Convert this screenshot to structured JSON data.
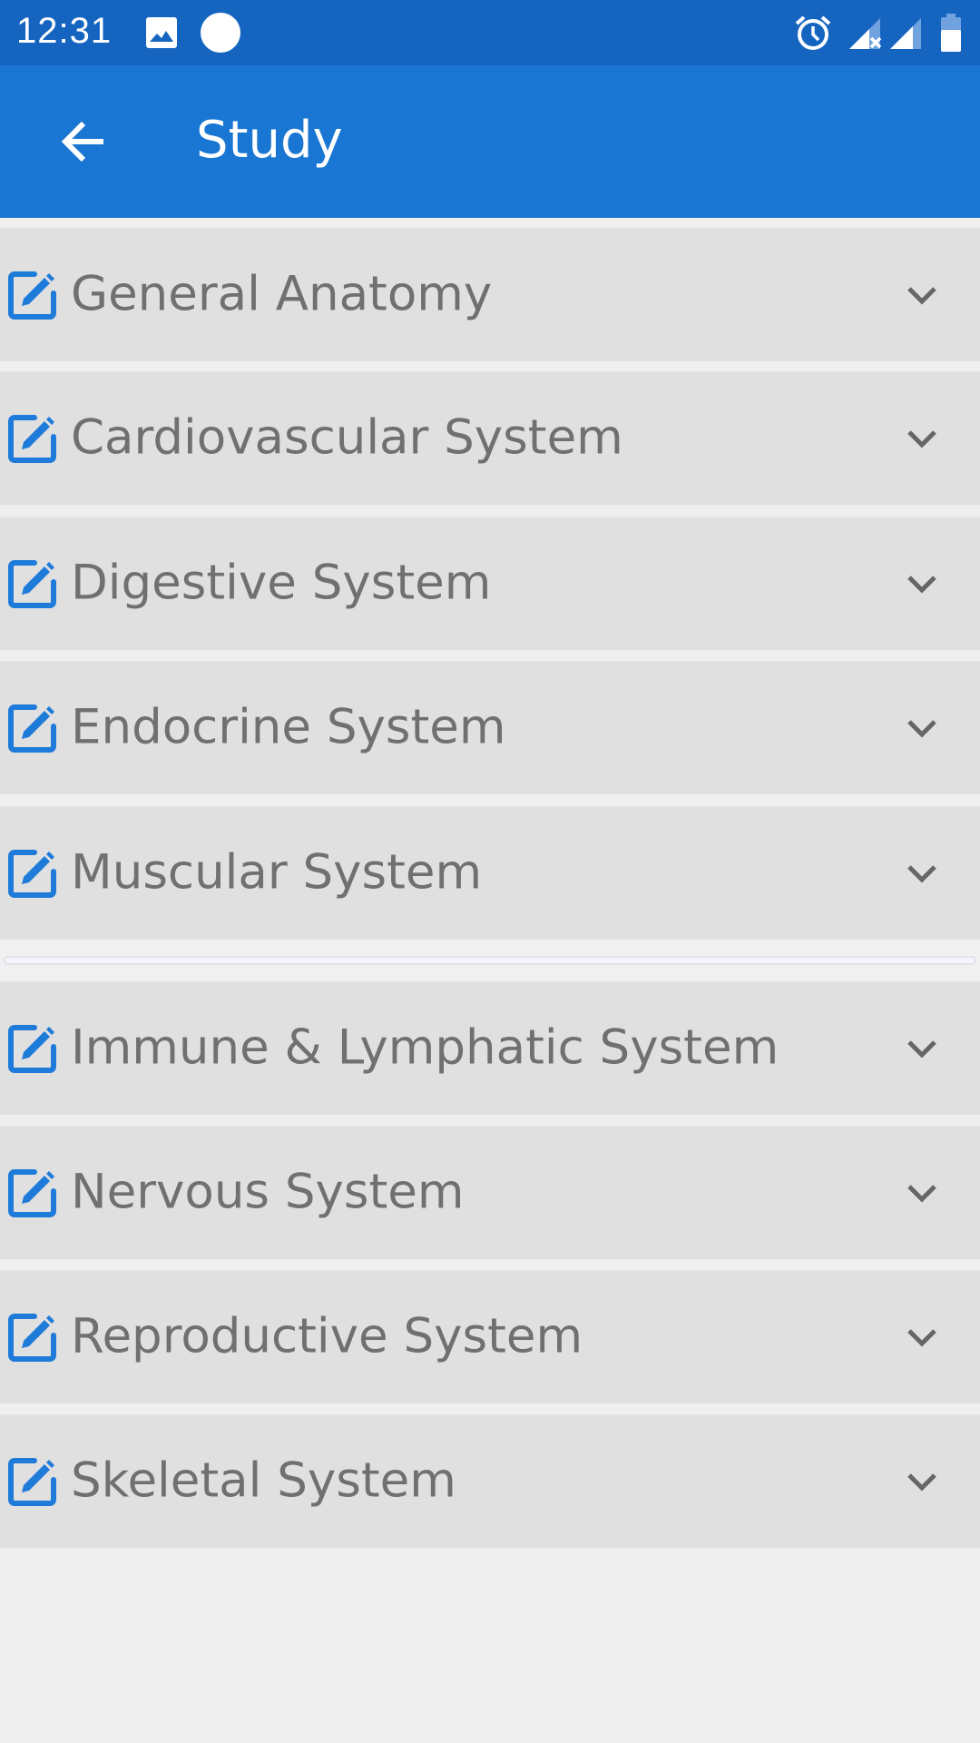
{
  "status_bar": {
    "time": "12:31",
    "left_icons": [
      "image-icon",
      "circle-notification-icon"
    ],
    "right_icons": [
      "alarm-icon",
      "signal-no-data-icon",
      "signal-icon",
      "battery-icon"
    ]
  },
  "app_bar": {
    "back_icon": "arrow-back-icon",
    "title": "Study"
  },
  "colors": {
    "status_bar": "#1565C0",
    "app_bar": "#1976D2",
    "accent_icon": "#1E7BD9",
    "row_background": "#E0E0E0",
    "row_text": "#707070",
    "page_background": "#EFEFEF"
  },
  "sections": [
    {
      "label": "General Anatomy",
      "icon": "edit-icon",
      "expand_icon": "chevron-down-icon"
    },
    {
      "label": "Cardiovascular System",
      "icon": "edit-icon",
      "expand_icon": "chevron-down-icon"
    },
    {
      "label": "Digestive System",
      "icon": "edit-icon",
      "expand_icon": "chevron-down-icon"
    },
    {
      "label": "Endocrine System",
      "icon": "edit-icon",
      "expand_icon": "chevron-down-icon"
    },
    {
      "label": "Muscular System",
      "icon": "edit-icon",
      "expand_icon": "chevron-down-icon"
    },
    {
      "label": "Immune & Lymphatic System",
      "icon": "edit-icon",
      "expand_icon": "chevron-down-icon"
    },
    {
      "label": "Nervous System",
      "icon": "edit-icon",
      "expand_icon": "chevron-down-icon"
    },
    {
      "label": "Reproductive System",
      "icon": "edit-icon",
      "expand_icon": "chevron-down-icon"
    },
    {
      "label": "Skeletal System",
      "icon": "edit-icon",
      "expand_icon": "chevron-down-icon"
    }
  ]
}
